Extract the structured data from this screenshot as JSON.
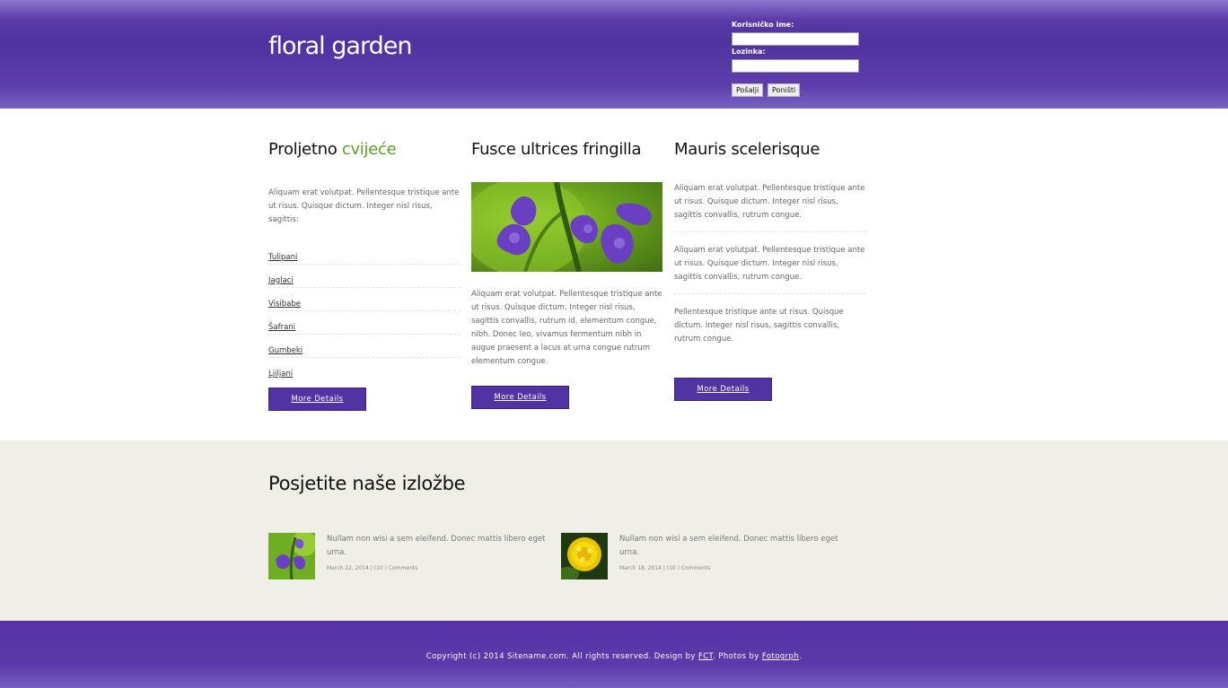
{
  "header": {
    "logo": "floral garden",
    "login": {
      "username_label": "Korisničko ime:",
      "username_value": "",
      "password_label": "Lozinka:",
      "password_value": "",
      "submit_label": "Pošalji",
      "reset_label": "Poništi"
    }
  },
  "columns": [
    {
      "title_main": "Proljetno ",
      "title_accent": "cvijeće",
      "text": "Aliquam erat volutpat. Pellentesque tristique ante ut risus. Quisque dictum. Integer nisl risus, sagittis:",
      "links": [
        "Tulipani",
        "Jaglaci",
        "Visibabe",
        "Šafrani",
        "Gumbeki",
        "Ljiljani"
      ],
      "button": "More Details"
    },
    {
      "title": "Fusce ultrices fringilla",
      "text": "Aliquam erat volutpat. Pellentesque tristique ante ut risus. Quisque dictum. Integer nisl risus, sagittis convallis, rutrum id, elementum congue, nibh. Donec leo, vivamus fermentum nibh in augue praesent a lacus at urna congue rutrum elementum congue.",
      "button": "More Details"
    },
    {
      "title": "Mauris scelerisque",
      "blocks": [
        "Aliquam erat volutpat. Pellentesque tristique ante ut risus. Quisque dictum. Integer nisl risus, sagittis convallis, rutrum congue.",
        "Aliquam erat volutpat. Pellentesque tristique ante ut risus. Quisque dictum. Integer nisl risus, sagittis convallis, rutrum congue.",
        "Pellentesque tristique ante ut risus. Quisque dictum. Integer nisl risus, sagittis convallis, rutrum congue."
      ],
      "button": "More Details"
    }
  ],
  "gallery": {
    "title": "Posjetite naše izložbe",
    "items": [
      {
        "text": "Nullam non wisi a sem eleifend. Donec mattis libero eget urna.",
        "meta": "March 22, 2014 | (10 ) Comments",
        "thumb": "purple-flower"
      },
      {
        "text": "Nullam non wisi a sem eleifend. Donec mattis libero eget urna.",
        "meta": "March 18, 2014 | (10 ) Comments",
        "thumb": "yellow-marigold"
      }
    ]
  },
  "footer": {
    "prefix": "Copyright (c) 2014 Sitename.com.  All rights reserved.  Design by ",
    "design_link": "FCT",
    "middle": ".  Photos by ",
    "photos_link": "Fotogrph",
    "suffix": "."
  },
  "colors": {
    "brand_purple": "#5233a3",
    "accent_green": "#5e9e2a",
    "gallery_bg": "#efefe8"
  }
}
